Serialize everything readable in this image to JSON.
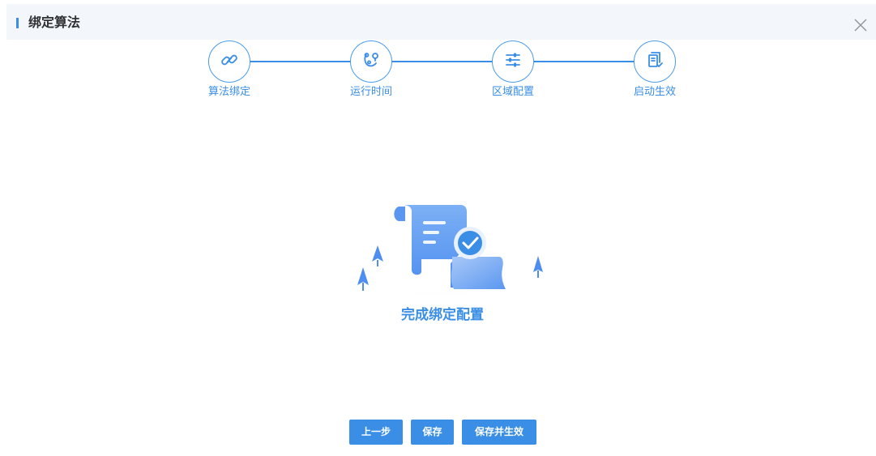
{
  "dialog": {
    "title": "绑定算法",
    "close_icon": "close-icon"
  },
  "steps": [
    {
      "label": "算法绑定",
      "icon": "link-icon"
    },
    {
      "label": "运行时间",
      "icon": "clock-route-icon"
    },
    {
      "label": "区域配置",
      "icon": "sliders-icon"
    },
    {
      "label": "启动生效",
      "icon": "document-check-icon"
    }
  ],
  "result": {
    "message": "完成绑定配置",
    "illustration": "scroll-check-illustration"
  },
  "buttons": {
    "prev": "上一步",
    "save": "保存",
    "save_activate": "保存并生效"
  },
  "colors": {
    "accent": "#3a8ee6",
    "header_bg": "#f3f6fb"
  }
}
